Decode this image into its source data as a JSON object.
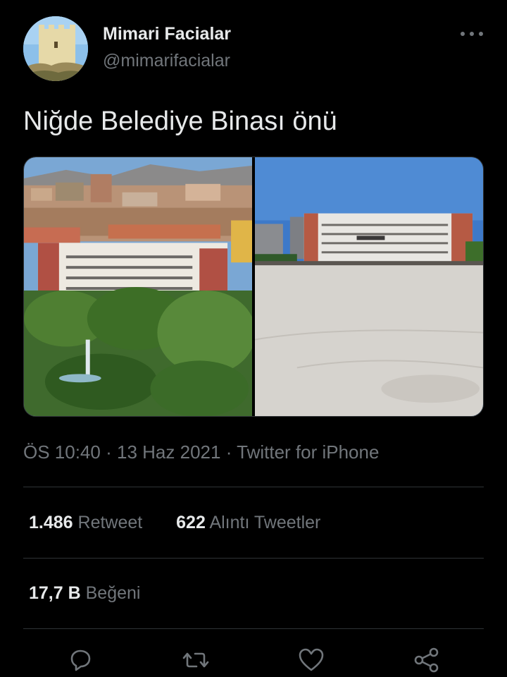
{
  "user": {
    "display_name": "Mimari Facialar",
    "handle": "@mimarifacialar"
  },
  "tweet": {
    "text": "Niğde Belediye Binası önü",
    "time": "ÖS 10:40",
    "date": "13 Haz 2021",
    "source": "Twitter for iPhone",
    "separator": "·"
  },
  "stats": {
    "retweets": "1.486",
    "retweets_label": "Retweet",
    "quotes": "622",
    "quotes_label": "Alıntı Tweetler",
    "likes": "17,7 B",
    "likes_label": "Beğeni"
  },
  "icons": {
    "more": "more-horizontal-icon",
    "reply": "reply-icon",
    "retweet": "retweet-icon",
    "like": "heart-icon",
    "share": "share-icon"
  },
  "colors": {
    "background": "#000000",
    "text_primary": "#e7e9ea",
    "text_secondary": "#71767b",
    "divider": "#2f3336"
  }
}
